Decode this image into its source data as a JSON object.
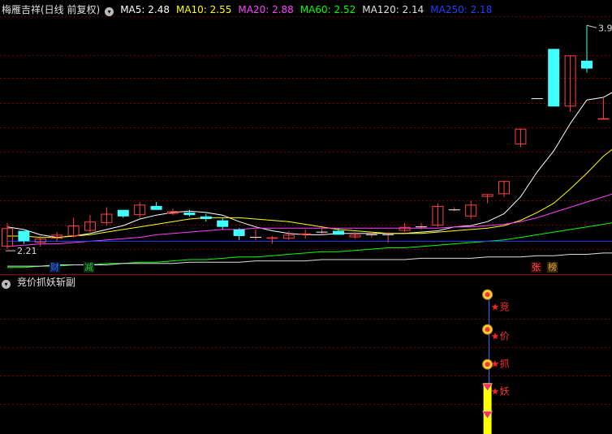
{
  "header": {
    "title": "梅雁吉祥(日线 前复权)",
    "ma": [
      {
        "label": "MA5: 2.48",
        "color": "#ffffff"
      },
      {
        "label": "MA10: 2.55",
        "color": "#ffff00"
      },
      {
        "label": "MA20: 2.88",
        "color": "#ff40ff"
      },
      {
        "label": "MA60: 2.52",
        "color": "#00ff00"
      },
      {
        "label": "MA120: 2.14",
        "color": "#e0e0e0"
      },
      {
        "label": "MA250: 2.18",
        "color": "#2040ff"
      }
    ]
  },
  "subpanel": {
    "title": "竞价抓妖斩副"
  },
  "badges": [
    {
      "text": "财",
      "color": "#3070ff",
      "bg": "#0a1a3a"
    },
    {
      "text": "减",
      "color": "#30c040",
      "bg": "#0a2a10"
    },
    {
      "text": "张",
      "color": "#ff5050",
      "bg": "#3a0a0a"
    },
    {
      "text": "榜",
      "color": "#e0a040",
      "bg": "#3a2a0a"
    }
  ],
  "signals": [
    "竞",
    "价",
    "抓",
    "妖"
  ],
  "colors": {
    "up": "#ff4040",
    "down": "#40ffff",
    "grid": "#800000"
  },
  "chart_data": {
    "type": "candlestick",
    "ylim": [
      2.12,
      3.98
    ],
    "max_label": "3.91",
    "min_label": "2.21",
    "candles": [
      {
        "o": 2.22,
        "h": 2.4,
        "l": 2.2,
        "c": 2.36
      },
      {
        "o": 2.34,
        "h": 2.34,
        "l": 2.24,
        "c": 2.26
      },
      {
        "o": 2.25,
        "h": 2.3,
        "l": 2.22,
        "c": 2.28
      },
      {
        "o": 2.28,
        "h": 2.33,
        "l": 2.26,
        "c": 2.31
      },
      {
        "o": 2.3,
        "h": 2.44,
        "l": 2.29,
        "c": 2.38
      },
      {
        "o": 2.34,
        "h": 2.46,
        "l": 2.33,
        "c": 2.41
      },
      {
        "o": 2.4,
        "h": 2.52,
        "l": 2.38,
        "c": 2.47
      },
      {
        "o": 2.5,
        "h": 2.5,
        "l": 2.44,
        "c": 2.45
      },
      {
        "o": 2.46,
        "h": 2.56,
        "l": 2.44,
        "c": 2.54
      },
      {
        "o": 2.53,
        "h": 2.56,
        "l": 2.5,
        "c": 2.5
      },
      {
        "o": 2.47,
        "h": 2.51,
        "l": 2.46,
        "c": 2.49
      },
      {
        "o": 2.48,
        "h": 2.5,
        "l": 2.45,
        "c": 2.46
      },
      {
        "o": 2.45,
        "h": 2.47,
        "l": 2.41,
        "c": 2.43
      },
      {
        "o": 2.42,
        "h": 2.44,
        "l": 2.35,
        "c": 2.37
      },
      {
        "o": 2.35,
        "h": 2.36,
        "l": 2.27,
        "c": 2.3
      },
      {
        "o": 2.29,
        "h": 2.35,
        "l": 2.27,
        "c": 2.29
      },
      {
        "o": 2.28,
        "h": 2.3,
        "l": 2.24,
        "c": 2.29
      },
      {
        "o": 2.28,
        "h": 2.34,
        "l": 2.27,
        "c": 2.31
      },
      {
        "o": 2.31,
        "h": 2.35,
        "l": 2.28,
        "c": 2.32
      },
      {
        "o": 2.33,
        "h": 2.36,
        "l": 2.31,
        "c": 2.33
      },
      {
        "o": 2.34,
        "h": 2.36,
        "l": 2.31,
        "c": 2.31
      },
      {
        "o": 2.29,
        "h": 2.33,
        "l": 2.28,
        "c": 2.31
      },
      {
        "o": 2.31,
        "h": 2.33,
        "l": 2.29,
        "c": 2.31
      },
      {
        "o": 2.31,
        "h": 2.33,
        "l": 2.25,
        "c": 2.31
      },
      {
        "o": 2.34,
        "h": 2.4,
        "l": 2.33,
        "c": 2.37
      },
      {
        "o": 2.37,
        "h": 2.4,
        "l": 2.35,
        "c": 2.37
      },
      {
        "o": 2.38,
        "h": 2.55,
        "l": 2.37,
        "c": 2.53
      },
      {
        "o": 2.5,
        "h": 2.52,
        "l": 2.49,
        "c": 2.5
      },
      {
        "o": 2.45,
        "h": 2.57,
        "l": 2.43,
        "c": 2.54
      },
      {
        "o": 2.6,
        "h": 2.62,
        "l": 2.55,
        "c": 2.62
      },
      {
        "o": 2.62,
        "h": 2.72,
        "l": 2.6,
        "c": 2.72
      },
      {
        "o": 3.0,
        "h": 3.12,
        "l": 2.98,
        "c": 3.12
      },
      {
        "o": 3.35,
        "h": 3.35,
        "l": 3.35,
        "c": 3.35
      },
      {
        "o": 3.73,
        "h": 3.73,
        "l": 3.29,
        "c": 3.29
      },
      {
        "o": 3.29,
        "h": 3.68,
        "l": 3.25,
        "c": 3.68
      },
      {
        "o": 3.64,
        "h": 3.91,
        "l": 3.55,
        "c": 3.58
      },
      {
        "o": 3.19,
        "h": 3.36,
        "l": 3.19,
        "c": 3.2
      },
      {
        "o": 3.22,
        "h": 3.42,
        "l": 3.22,
        "c": 3.31
      },
      {
        "o": 3.36,
        "h": 3.39,
        "l": 3.18,
        "c": 3.2
      },
      {
        "o": 3.29,
        "h": 3.38,
        "l": 3.24,
        "c": 3.24
      }
    ],
    "ma_lines": {
      "ma5": [
        2.37,
        2.35,
        2.31,
        2.29,
        2.3,
        2.32,
        2.35,
        2.38,
        2.43,
        2.46,
        2.48,
        2.49,
        2.48,
        2.46,
        2.41,
        2.37,
        2.34,
        2.32,
        2.31,
        2.31,
        2.32,
        2.32,
        2.32,
        2.32,
        2.32,
        2.33,
        2.34,
        2.37,
        2.38,
        2.41,
        2.47,
        2.6,
        2.79,
        2.95,
        3.16,
        3.34,
        3.36,
        3.43,
        3.43,
        3.36
      ],
      "ma10": [
        2.3,
        2.3,
        2.29,
        2.29,
        2.3,
        2.31,
        2.33,
        2.35,
        2.37,
        2.39,
        2.41,
        2.43,
        2.44,
        2.44,
        2.44,
        2.43,
        2.42,
        2.41,
        2.39,
        2.37,
        2.35,
        2.34,
        2.33,
        2.32,
        2.32,
        2.32,
        2.33,
        2.34,
        2.35,
        2.36,
        2.38,
        2.42,
        2.48,
        2.55,
        2.66,
        2.78,
        2.91,
        3.01,
        3.09,
        3.15
      ],
      "ma20": [
        2.22,
        2.23,
        2.24,
        2.24,
        2.25,
        2.26,
        2.27,
        2.28,
        2.29,
        2.31,
        2.32,
        2.33,
        2.34,
        2.35,
        2.35,
        2.36,
        2.36,
        2.36,
        2.36,
        2.36,
        2.36,
        2.36,
        2.36,
        2.36,
        2.36,
        2.36,
        2.36,
        2.37,
        2.37,
        2.38,
        2.39,
        2.41,
        2.44,
        2.48,
        2.52,
        2.56,
        2.6,
        2.64,
        2.67,
        2.69
      ],
      "ma60": [
        2.06,
        2.06,
        2.07,
        2.07,
        2.08,
        2.08,
        2.09,
        2.09,
        2.1,
        2.1,
        2.11,
        2.12,
        2.12,
        2.13,
        2.14,
        2.14,
        2.15,
        2.16,
        2.17,
        2.18,
        2.18,
        2.19,
        2.2,
        2.21,
        2.21,
        2.22,
        2.23,
        2.24,
        2.25,
        2.26,
        2.27,
        2.29,
        2.31,
        2.33,
        2.35,
        2.37,
        2.39,
        2.41,
        2.42,
        2.43
      ],
      "ma120": [
        2.07,
        2.07,
        2.07,
        2.08,
        2.08,
        2.08,
        2.08,
        2.09,
        2.09,
        2.09,
        2.09,
        2.1,
        2.1,
        2.1,
        2.1,
        2.11,
        2.11,
        2.11,
        2.11,
        2.12,
        2.12,
        2.12,
        2.12,
        2.12,
        2.12,
        2.13,
        2.13,
        2.13,
        2.13,
        2.14,
        2.14,
        2.14,
        2.15,
        2.15,
        2.16,
        2.16,
        2.17,
        2.17,
        2.17,
        2.17
      ],
      "ma250": [
        2.26,
        2.26,
        2.26,
        2.26,
        2.26,
        2.26,
        2.26,
        2.26,
        2.26,
        2.26,
        2.26,
        2.26,
        2.26,
        2.26,
        2.26,
        2.26,
        2.26,
        2.26,
        2.26,
        2.26,
        2.26,
        2.26,
        2.26,
        2.26,
        2.26,
        2.26,
        2.26,
        2.26,
        2.26,
        2.26,
        2.26,
        2.26,
        2.26,
        2.26,
        2.26,
        2.26,
        2.26,
        2.26,
        2.26,
        2.26
      ]
    },
    "ma_colors": {
      "ma5": "#ffffff",
      "ma10": "#ffff00",
      "ma20": "#ff40ff",
      "ma60": "#00ff00",
      "ma120": "#e0e0e0",
      "ma250": "#2040ff"
    },
    "signal_bars": {
      "index": 29,
      "circle_levels": [
        0.96,
        0.72,
        0.48
      ],
      "gem_levels": [
        0.33,
        0.14
      ],
      "yellow_range": [
        0.0,
        0.35
      ]
    }
  }
}
